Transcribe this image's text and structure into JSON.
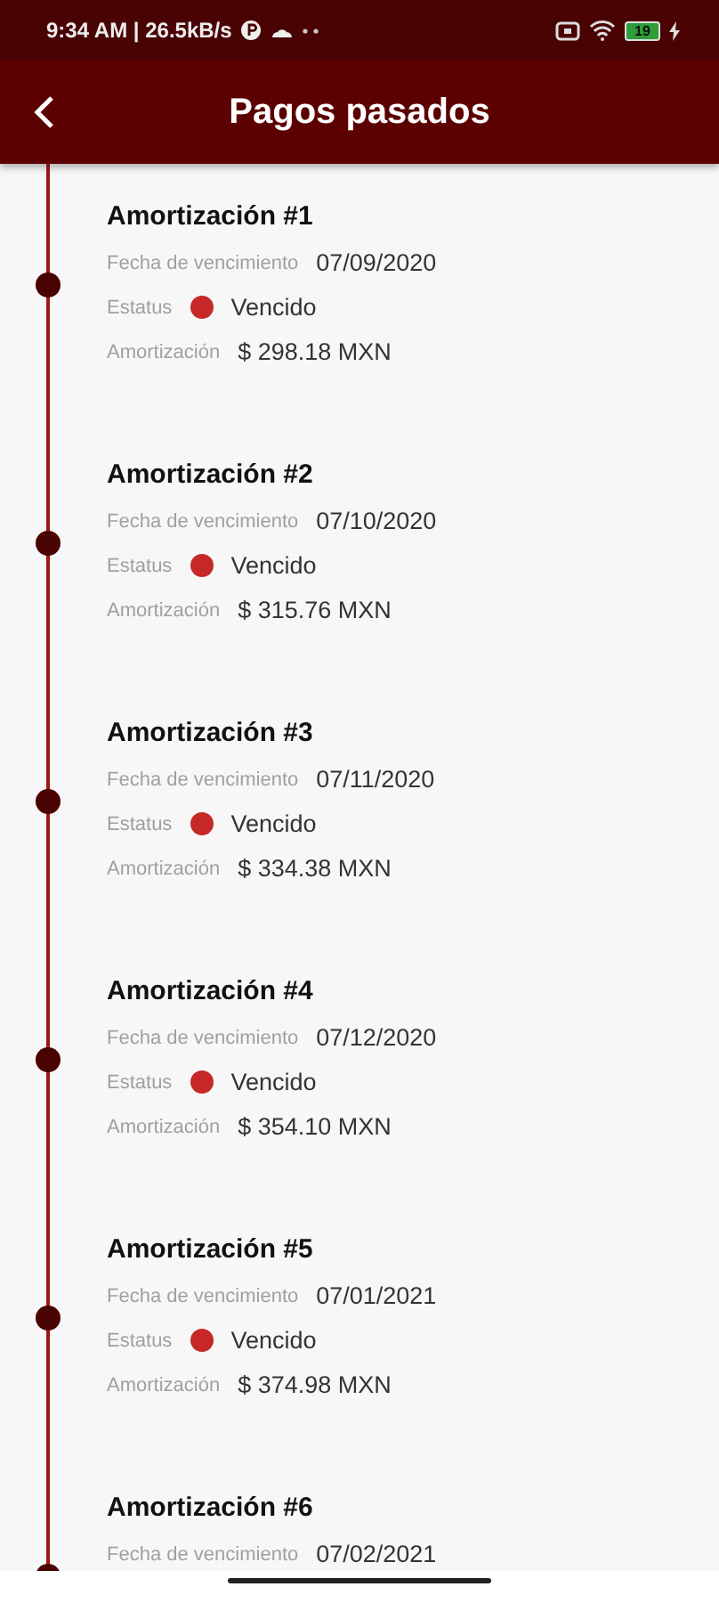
{
  "status_bar": {
    "time": "9:34 AM | 26.5kB/s",
    "battery": "19"
  },
  "app_bar": {
    "title": "Pagos pasados"
  },
  "payments": [
    {
      "title": "Amortización #1",
      "due_label": "Fecha de vencimiento",
      "due_date": "07/09/2020",
      "status_label": "Estatus",
      "status": "Vencido",
      "color": "#c62828",
      "amount_label": "Amortización",
      "amount": "$ 298.18 MXN"
    },
    {
      "title": "Amortización #2",
      "due_label": "Fecha de vencimiento",
      "due_date": "07/10/2020",
      "status_label": "Estatus",
      "status": "Vencido",
      "color": "#c62828",
      "amount_label": "Amortización",
      "amount": "$ 315.76 MXN"
    },
    {
      "title": "Amortización #3",
      "due_label": "Fecha de vencimiento",
      "due_date": "07/11/2020",
      "status_label": "Estatus",
      "status": "Vencido",
      "color": "#c62828",
      "amount_label": "Amortización",
      "amount": "$ 334.38 MXN"
    },
    {
      "title": "Amortización #4",
      "due_label": "Fecha de vencimiento",
      "due_date": "07/12/2020",
      "status_label": "Estatus",
      "status": "Vencido",
      "color": "#c62828",
      "amount_label": "Amortización",
      "amount": "$ 354.10 MXN"
    },
    {
      "title": "Amortización #5",
      "due_label": "Fecha de vencimiento",
      "due_date": "07/01/2021",
      "status_label": "Estatus",
      "status": "Vencido",
      "color": "#c62828",
      "amount_label": "Amortización",
      "amount": "$ 374.98 MXN"
    },
    {
      "title": "Amortización #6",
      "due_label": "Fecha de vencimiento",
      "due_date": "07/02/2021"
    }
  ]
}
